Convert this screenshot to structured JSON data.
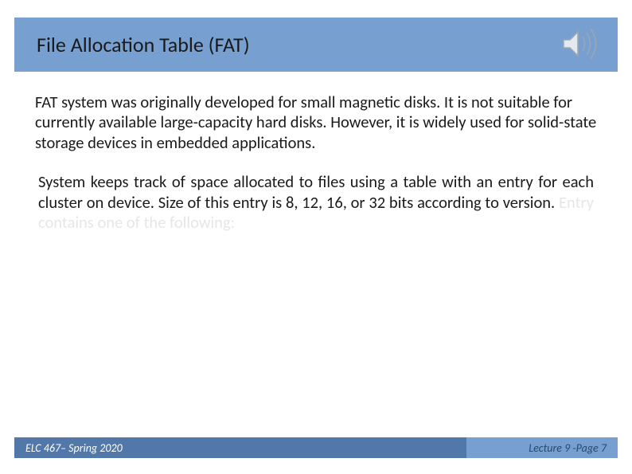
{
  "title": "File Allocation Table (FAT)",
  "para1": "FAT system was originally developed for small magnetic disks.  It is not suitable for currently available large-capacity hard disks.  However, it is widely used for solid-state storage devices in embedded applications.",
  "para2a": "System keeps track of space allocated to files using a table with an entry for each cluster on device.  Size of this entry is 8, 12, 16, or 32 bits according to version.  ",
  "para2b": "Entry contains one of the following:",
  "footer": {
    "left": "ELC 467– Spring 2020",
    "right": "Lecture 9 -Page 7"
  },
  "icons": {
    "speaker": "speaker-icon"
  }
}
